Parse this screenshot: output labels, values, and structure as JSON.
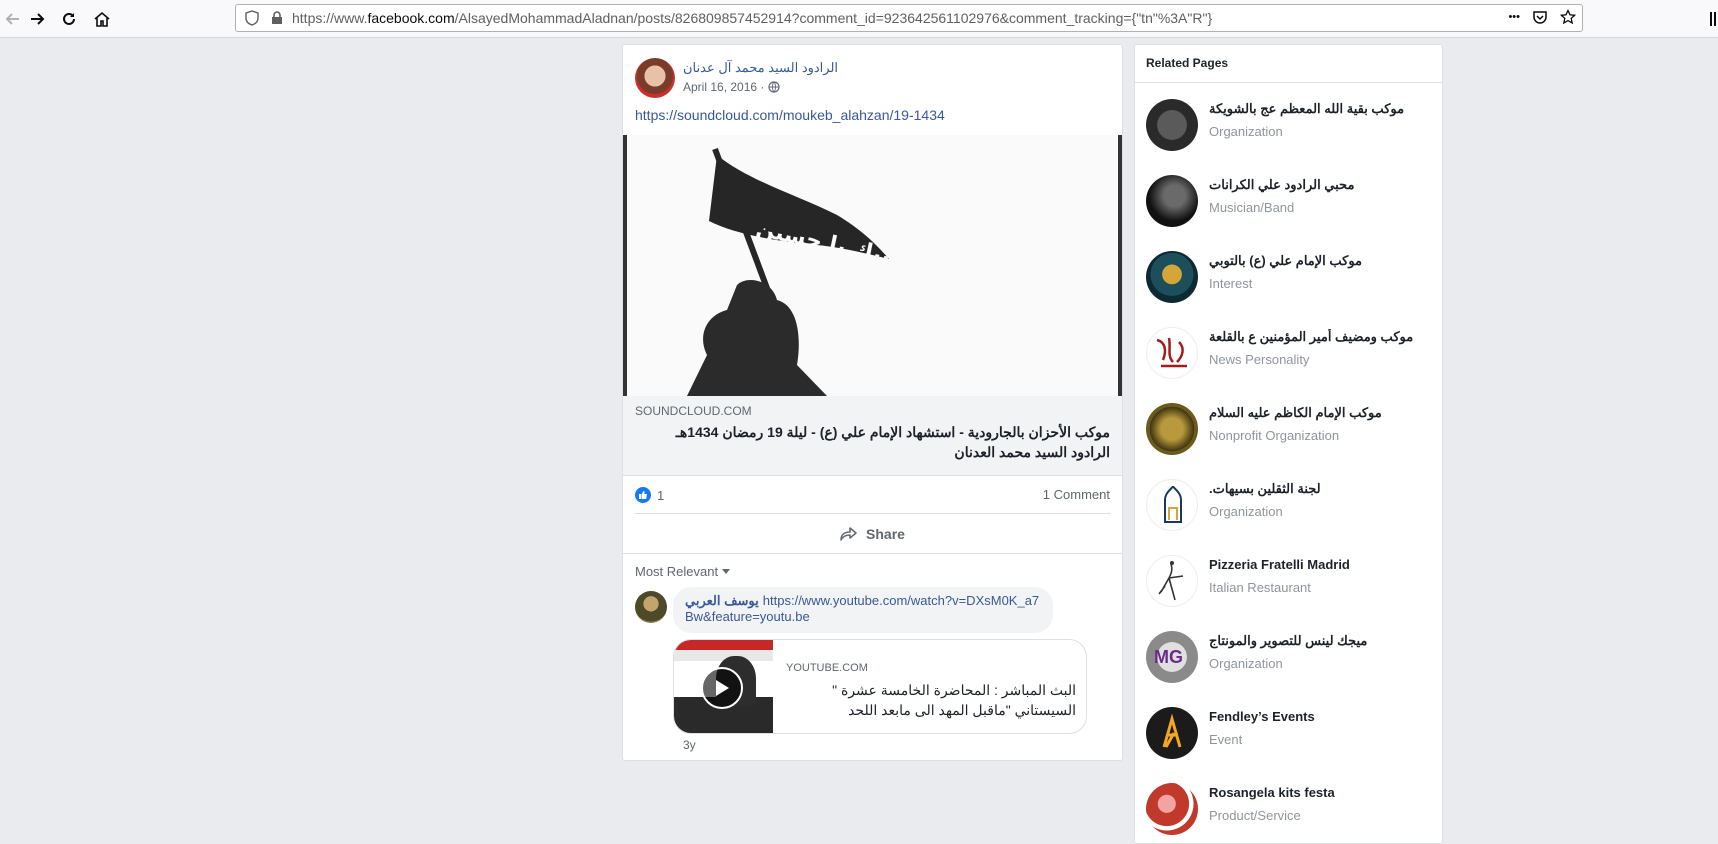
{
  "browser": {
    "url_prefix": "https://www.",
    "url_domain": "facebook.com",
    "url_rest": "/AlsayedMohammadAladnan/posts/826809857452914?comment_id=923642561102976&comment_tracking={\"tn\"%3A\"R\"}",
    "more_glyph": "•••"
  },
  "post": {
    "author": "الرادود السيد محمد آل عدنان",
    "date": "April 16, 2016 ·",
    "link_text": "https://soundcloud.com/moukeb_alahzan/19-1434",
    "image_banner_text": "لبيك يا حسين",
    "link_domain": "SOUNDCLOUD.COM",
    "link_title": "موكب الأحزان بالجارودية - استشهاد الإمام علي (ع) - ليلة 19 رمضان 1434هـ الرادود السيد محمد العدنان",
    "like_count": "1",
    "comment_count": "1 Comment",
    "share_label": "Share",
    "sort_label": "Most Relevant"
  },
  "comment": {
    "author": "يوسف العربي",
    "link": "https://www.youtube.com/watch?v=DXsM0K_a7Bw&feature=youtu.be",
    "preview_domain": "YOUTUBE.COM",
    "preview_title": "البث المباشر : المحاضرة الخامسة عشرة \" السيستاني \"ماقبل المهد الى مابعد اللحد",
    "time": "3y"
  },
  "related": {
    "title": "Related Pages",
    "pages": [
      {
        "name": "موكب بقية الله المعظم عج بالشويكة",
        "category": "Organization",
        "color": "#3a3a3a"
      },
      {
        "name": "محبي الرادود علي الكرانات",
        "category": "Musician/Band",
        "color": "#1e1e1e"
      },
      {
        "name": "موكب الإمام علي (ع) بالتوبي",
        "category": "Interest",
        "color": "#0f2f3a"
      },
      {
        "name": "موكب ومضيف أمير المؤمنين ع بالقلعة",
        "category": "News Personality",
        "color": "#ffffff"
      },
      {
        "name": "موكب الإمام الكاظم عليه السلام",
        "category": "Nonprofit Organization",
        "color": "#6b5a1e"
      },
      {
        "name": "لجنة الثقلين بسيهات.",
        "category": "Organization",
        "color": "#ffffff"
      },
      {
        "name": "Pizzeria Fratelli Madrid",
        "category": "Italian Restaurant",
        "color": "#ffffff"
      },
      {
        "name": "ميجك لينس للتصوير والمونتاج",
        "category": "Organization",
        "color": "#8a8a8a"
      },
      {
        "name": "Fendley’s Events",
        "category": "Event",
        "color": "#1b1b1b"
      },
      {
        "name": "Rosangela kits festa",
        "category": "Product/Service",
        "color": "#c0392b"
      }
    ]
  }
}
